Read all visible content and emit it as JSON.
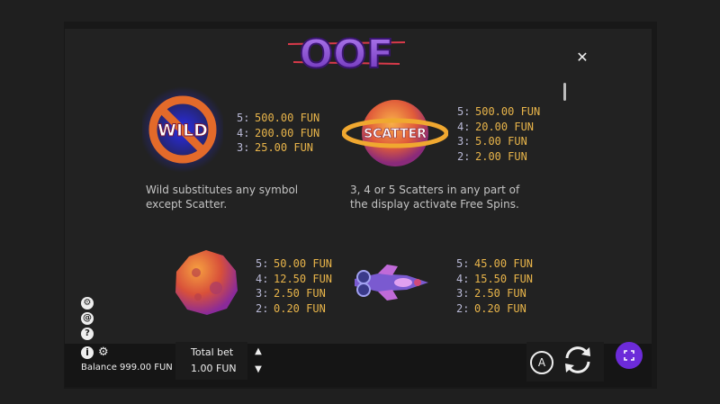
{
  "game": {
    "logo_text": "OOF"
  },
  "paytable": {
    "wild": {
      "label": "WILD",
      "pays": [
        {
          "count": "5:",
          "value": "500.00 FUN"
        },
        {
          "count": "4:",
          "value": "200.00 FUN"
        },
        {
          "count": "3:",
          "value": "25.00 FUN"
        }
      ],
      "description_line1": "Wild substitutes any symbol",
      "description_line2": "except Scatter."
    },
    "scatter": {
      "label": "SCATTER",
      "pays": [
        {
          "count": "5:",
          "value": "500.00 FUN"
        },
        {
          "count": "4:",
          "value": "20.00 FUN"
        },
        {
          "count": "3:",
          "value": "5.00 FUN"
        },
        {
          "count": "2:",
          "value": "2.00 FUN"
        }
      ],
      "description_line1": "3, 4 or 5 Scatters in any part of",
      "description_line2": "the display activate Free Spins."
    },
    "asteroid": {
      "pays": [
        {
          "count": "5:",
          "value": "50.00 FUN"
        },
        {
          "count": "4:",
          "value": "12.50 FUN"
        },
        {
          "count": "3:",
          "value": "2.50 FUN"
        },
        {
          "count": "2:",
          "value": "0.20 FUN"
        }
      ]
    },
    "spaceship": {
      "pays": [
        {
          "count": "5:",
          "value": "45.00 FUN"
        },
        {
          "count": "4:",
          "value": "15.50 FUN"
        },
        {
          "count": "3:",
          "value": "2.50 FUN"
        },
        {
          "count": "2:",
          "value": "0.20 FUN"
        }
      ]
    }
  },
  "bottom_bar": {
    "balance_label": "Balance 999.00 FUN",
    "total_bet_label": "Total bet",
    "total_bet_value": "1.00 FUN",
    "autoplay_label": "A"
  },
  "colors": {
    "pay_value": "#e8b44a",
    "pay_count": "#b9b9d6",
    "accent": "#6c2bd9"
  }
}
